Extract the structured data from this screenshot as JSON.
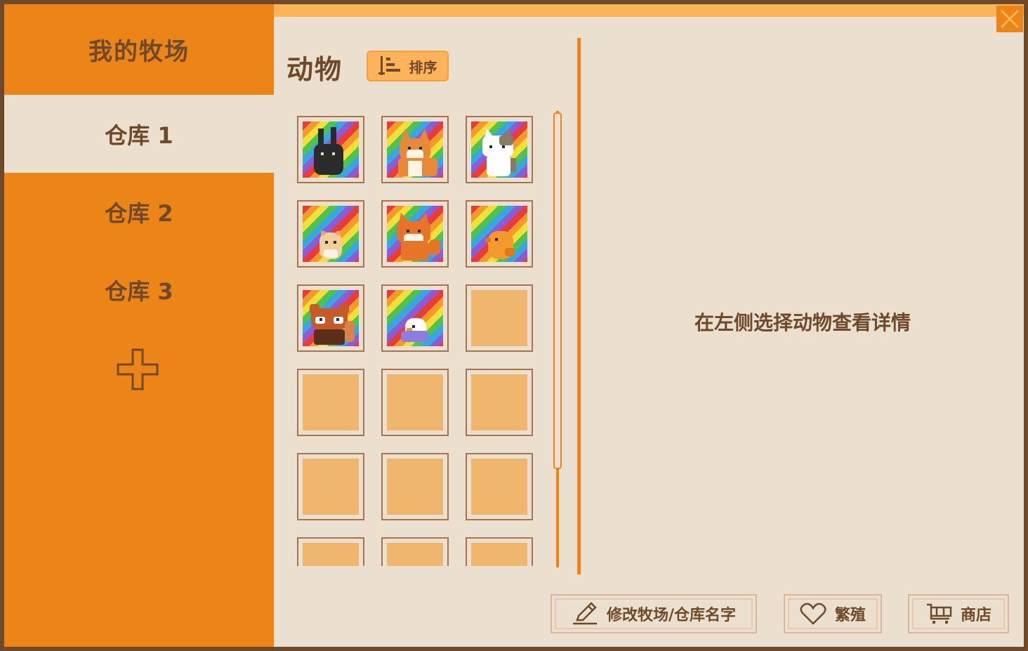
{
  "sidebar": {
    "title": "我的牧场",
    "warehouses": [
      {
        "label": "仓库 1",
        "active": true
      },
      {
        "label": "仓库 2",
        "active": false
      },
      {
        "label": "仓库 3",
        "active": false
      }
    ],
    "add_icon": "plus-icon"
  },
  "animals_panel": {
    "title": "动物",
    "sort_label": "排序",
    "sort_icon": "sort-bars-icon",
    "slots": [
      {
        "animal": "black-rabbit",
        "background": "rainbow"
      },
      {
        "animal": "corgi",
        "background": "rainbow"
      },
      {
        "animal": "calico-cat",
        "background": "rainbow"
      },
      {
        "animal": "hamster",
        "background": "rainbow"
      },
      {
        "animal": "fox",
        "background": "rainbow"
      },
      {
        "animal": "orange-chick",
        "background": "rainbow"
      },
      {
        "animal": "red-panda",
        "background": "rainbow"
      },
      {
        "animal": "bluebird",
        "background": "rainbow"
      },
      {
        "animal": null
      },
      {
        "animal": null
      },
      {
        "animal": null
      },
      {
        "animal": null
      },
      {
        "animal": null
      },
      {
        "animal": null
      },
      {
        "animal": null
      },
      {
        "animal": null
      },
      {
        "animal": null
      },
      {
        "animal": null
      }
    ]
  },
  "details": {
    "hint": "在左侧选择动物查看详情"
  },
  "actions": {
    "rename_label": "修改牧场/仓库名字",
    "rename_icon": "pencil-icon",
    "breed_label": "繁殖",
    "breed_icon": "heart-icon",
    "shop_label": "商店",
    "shop_icon": "cart-icon"
  },
  "colors": {
    "sidebar": "#ec8418",
    "background": "#ebe0d0",
    "text": "#6e4a2a",
    "slot_empty": "#f0b66d",
    "accent_light": "#fdb35a"
  }
}
